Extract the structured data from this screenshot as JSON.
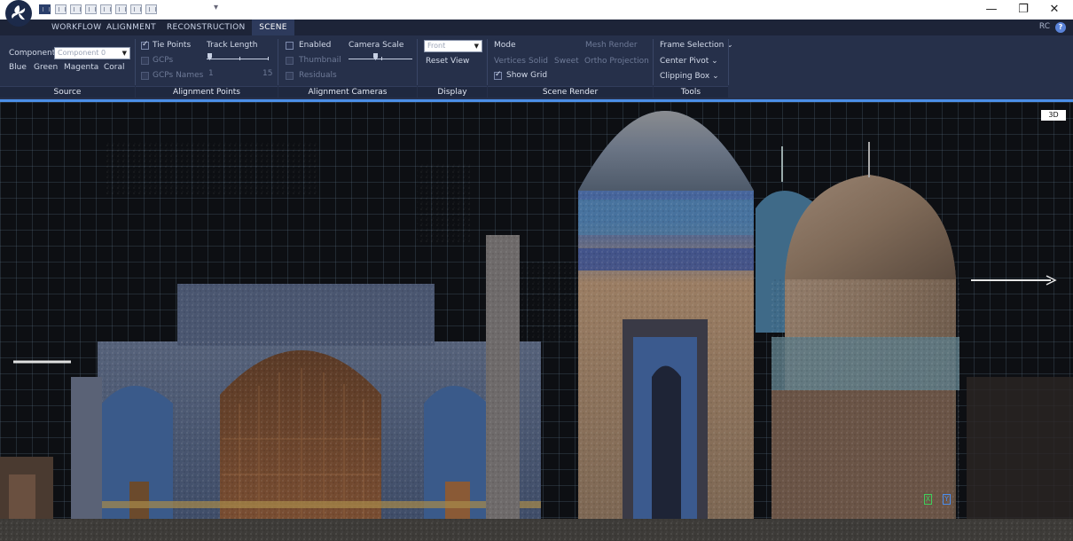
{
  "titlebar": {
    "quick_access": "▾",
    "minimize": "—",
    "restore": "❐",
    "close": "✕"
  },
  "tabs": [
    {
      "label": "WORKFLOW",
      "active": false
    },
    {
      "label": "ALIGNMENT",
      "active": false
    },
    {
      "label": "RECONSTRUCTION",
      "active": false
    },
    {
      "label": "SCENE",
      "active": true
    }
  ],
  "account": {
    "label": "RC",
    "help_icon": "help-icon"
  },
  "ribbon": {
    "source": {
      "component_label": "Component",
      "component_placeholder": "Component 0",
      "colors": [
        "Blue",
        "Green",
        "Magenta",
        "Coral"
      ],
      "group": "Source"
    },
    "alignment_points": {
      "tie_points": "Tie Points",
      "gcps": "GCPs",
      "gcps_names": "GCPs Names",
      "track_length": "Track Length",
      "track_min": "1",
      "track_max": "15",
      "group": "Alignment Points"
    },
    "alignment_cameras": {
      "enabled": "Enabled",
      "thumbnail": "Thumbnail",
      "residuals": "Residuals",
      "camera_scale": "Camera Scale",
      "group": "Alignment Cameras"
    },
    "display": {
      "view_value": "Front",
      "reset_view": "Reset View",
      "group": "Display"
    },
    "scene_render": {
      "mode": "Mode",
      "mesh_render": "Mesh Render",
      "vertices": "Vertices",
      "solid": "Solid",
      "sweet": "Sweet",
      "ortho_projection": "Ortho Projection",
      "show_grid": "Show Grid",
      "group": "Scene Render"
    },
    "tools": {
      "frame_selection": "Frame Selection",
      "center_pivot": "Center Pivot",
      "clipping_box": "Clipping Box",
      "chevron": "⌄",
      "group": "Tools"
    }
  },
  "viewport": {
    "view_badge": "3D",
    "gizmo_x": "X",
    "gizmo_y": "Y"
  },
  "colors": {
    "accent": "#4b8fe8",
    "ribbon": "#26304a",
    "tabbar": "#1d2438"
  }
}
